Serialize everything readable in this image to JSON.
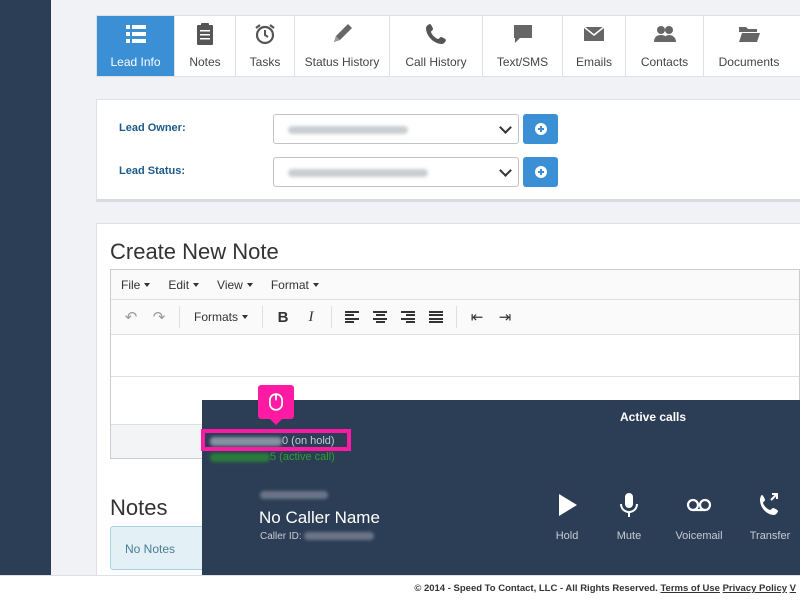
{
  "tabs": [
    {
      "label": "Lead Info",
      "icon": "list-icon"
    },
    {
      "label": "Notes",
      "icon": "clipboard-icon"
    },
    {
      "label": "Tasks",
      "icon": "alarm-clock-icon"
    },
    {
      "label": "Status History",
      "icon": "pencil-icon"
    },
    {
      "label": "Call History",
      "icon": "phone-icon"
    },
    {
      "label": "Text/SMS",
      "icon": "chat-icon"
    },
    {
      "label": "Emails",
      "icon": "envelope-icon"
    },
    {
      "label": "Contacts",
      "icon": "users-icon"
    },
    {
      "label": "Documents",
      "icon": "folder-icon"
    }
  ],
  "lead": {
    "owner_label": "Lead Owner:",
    "status_label": "Lead Status:"
  },
  "note": {
    "title": "Create New Note",
    "menu": [
      "File",
      "Edit",
      "View",
      "Format"
    ],
    "formats_label": "Formats"
  },
  "notes": {
    "title": "Notes",
    "empty": "No Notes"
  },
  "call_panel": {
    "title": "Active calls",
    "hold_suffix": "0 (on hold)",
    "active_suffix": "5 (active call)",
    "caller_name": "No Caller Name",
    "caller_id_label": "Caller ID:",
    "controls": [
      "Hold",
      "Mute",
      "Voicemail",
      "Transfer"
    ]
  },
  "footer": {
    "copyright": "© 2014 - Speed To Contact, LLC - All Rights Reserved.",
    "terms": "Terms of Use",
    "privacy": "Privacy Policy",
    "trailing": "V"
  },
  "colors": {
    "accent": "#3a8fd5",
    "sidebar": "#2c3e56",
    "highlight": "#ff1aa3",
    "active_call": "#2ca02c"
  }
}
